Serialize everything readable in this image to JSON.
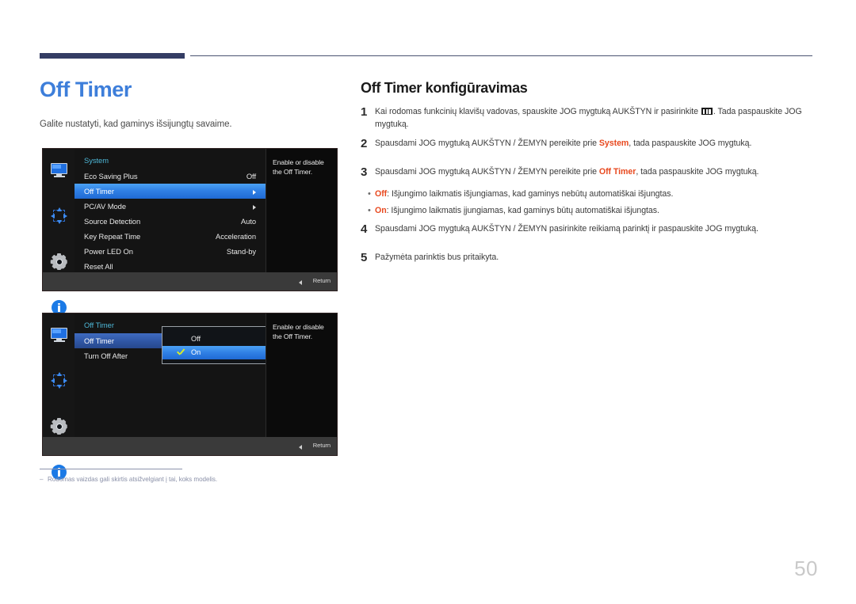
{
  "header": {
    "navy_bar": "",
    "rule": ""
  },
  "left": {
    "title": "Off Timer",
    "subtitle": "Galite nustatyti, kad gaminys išsijungtų savaime."
  },
  "right": {
    "section_title": "Off Timer konfigūravimas",
    "steps": [
      {
        "num": "1",
        "text_before": "Kai rodomas funkcinių klavišų vadovas, spauskite JOG mygtuką AUKŠTYN ir pasirinkite ",
        "icon": "menu-glyph-icon",
        "text_after": ". Tada paspauskite JOG mygtuką."
      },
      {
        "num": "2",
        "text_before": "Spausdami JOG mygtuką AUKŠTYN / ŽEMYN pereikite prie ",
        "highlight": "System",
        "text_after": ", tada paspauskite JOG mygtuką."
      },
      {
        "num": "3",
        "text_before": "Spausdami JOG mygtuką AUKŠTYN / ŽEMYN pereikite prie ",
        "highlight": "Off Timer",
        "text_after": ", tada paspauskite JOG mygtuką."
      }
    ],
    "bullets": [
      {
        "dot": "•",
        "highlight": "Off",
        "text": ": Išjungimo laikmatis išjungiamas, kad gaminys nebūtų automatiškai išjungtas."
      },
      {
        "dot": "•",
        "highlight": "On",
        "text": ": Išjungimo laikmatis įjungiamas, kad gaminys būtų automatiškai išjungtas."
      }
    ],
    "steps_after": [
      {
        "num": "4",
        "text": "Spausdami JOG mygtuką AUKŠTYN / ŽEMYN pasirinkite reikiamą parinktį ir paspauskite JOG mygtuką."
      },
      {
        "num": "5",
        "text": "Pažymėta parinktis bus pritaikyta."
      }
    ]
  },
  "osd1": {
    "heading": "System",
    "description": "Enable or disable the Off Timer.",
    "return_label": "Return",
    "sidebar_icons": [
      "monitor-icon",
      "move-arrows-icon",
      "gear-icon",
      "info-icon"
    ],
    "rows": [
      {
        "label": "Eco Saving Plus",
        "value": "Off",
        "arrow": false,
        "selected": false
      },
      {
        "label": "Off Timer",
        "value": "",
        "arrow": true,
        "selected": true
      },
      {
        "label": "PC/AV Mode",
        "value": "",
        "arrow": true,
        "selected": false
      },
      {
        "label": "Source Detection",
        "value": "Auto",
        "arrow": false,
        "selected": false
      },
      {
        "label": "Key Repeat Time",
        "value": "Acceleration",
        "arrow": false,
        "selected": false
      },
      {
        "label": "Power LED On",
        "value": "Stand-by",
        "arrow": false,
        "selected": false
      },
      {
        "label": "Reset All",
        "value": "",
        "arrow": false,
        "selected": false
      }
    ]
  },
  "osd2": {
    "heading": "Off Timer",
    "description": "Enable or disable the Off Timer.",
    "return_label": "Return",
    "rows": [
      {
        "label": "Off Timer",
        "value": "",
        "selected_dim": true
      },
      {
        "label": "Turn Off After",
        "value": "",
        "selected_dim": false
      }
    ],
    "submenu": [
      {
        "label": "Off",
        "checked": false,
        "selected": false
      },
      {
        "label": "On",
        "checked": true,
        "selected": true
      }
    ]
  },
  "footnote": {
    "dash": "‒",
    "text": "Rodomas vaizdas gali skirtis atsižvelgiant į tai, koks modelis."
  },
  "page_number": "50",
  "colors": {
    "accent_blue": "#3d7eda",
    "navy": "#343d64",
    "highlight_red": "#e8491f",
    "osd_heading": "#4eb8d8",
    "osd_select": "#2f7fe4",
    "check_green": "#d6ec2b",
    "page_num": "#c9c9c9"
  }
}
